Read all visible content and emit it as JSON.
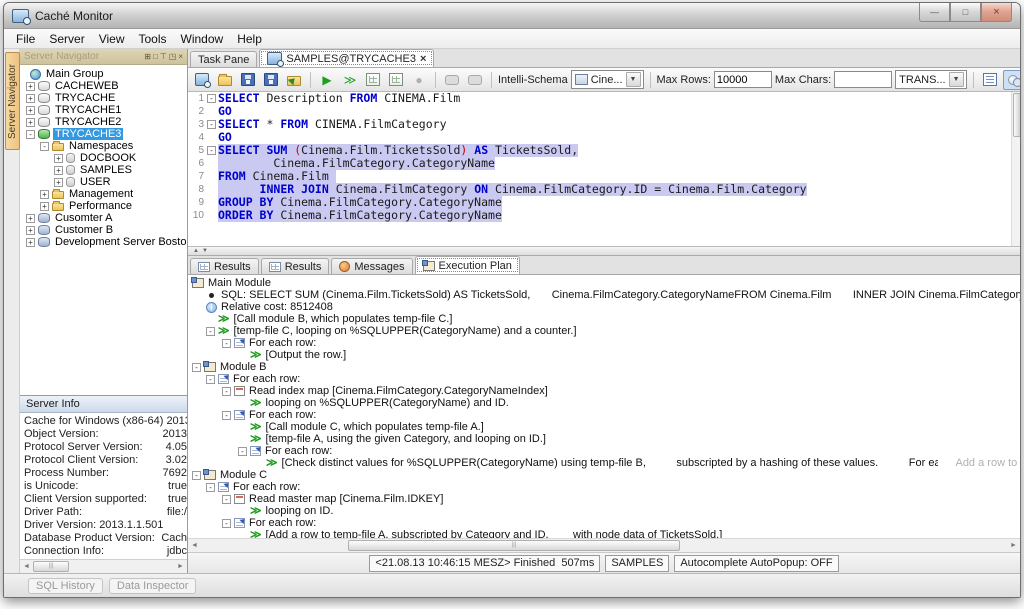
{
  "window": {
    "title": "Caché Monitor"
  },
  "icons": {
    "min": "—",
    "max": "□",
    "close": "×",
    "dock": "⊞",
    "pin": "⊤",
    "float": "◳",
    "plus": "+",
    "minus": "-",
    "dropdown": "▼",
    "play": "▶",
    "stop": "●",
    "up": "▲",
    "down": "▼",
    "left": "◄",
    "right": "►",
    "grip": "|||",
    "tabclose": "×",
    "info": "i",
    "go": "≫"
  },
  "menu": {
    "items": [
      "File",
      "Server",
      "View",
      "Tools",
      "Window",
      "Help"
    ]
  },
  "navigator": {
    "side_tab": "Server Navigator",
    "title": "Server Navigator",
    "tree": [
      {
        "label": "Main Group"
      },
      {
        "label": "CACHEWEB"
      },
      {
        "label": "TRYCACHE"
      },
      {
        "label": "TRYCACHE1"
      },
      {
        "label": "TRYCACHE2"
      },
      {
        "label": "TRYCACHE3"
      },
      {
        "label": "Namespaces"
      },
      {
        "label": "DOCBOOK"
      },
      {
        "label": "SAMPLES"
      },
      {
        "label": "USER"
      },
      {
        "label": "Management"
      },
      {
        "label": "Performance"
      },
      {
        "label": "Cusomter A"
      },
      {
        "label": "Customer B"
      },
      {
        "label": "Development Server Boston"
      }
    ]
  },
  "server_info": {
    "title": "Server Info",
    "rows": [
      {
        "label": "Cache for Windows (x86-64) 2013.",
        "value": ""
      },
      {
        "label": "Object Version:",
        "value": "2013"
      },
      {
        "label": "Protocol Server Version:",
        "value": "4.05"
      },
      {
        "label": "Protocol Client Version:",
        "value": "3.02"
      },
      {
        "label": "Process Number:",
        "value": "7692"
      },
      {
        "label": "is Unicode:",
        "value": "true"
      },
      {
        "label": "Client Version supported:",
        "value": "true"
      },
      {
        "label": "Driver Path:",
        "value": "file:/"
      },
      {
        "label": "Driver Version: 2013.1.1.501",
        "value": ""
      },
      {
        "label": "Database Product Version:",
        "value": "Cach"
      },
      {
        "label": "Connection Info:",
        "value": "jdbc"
      }
    ]
  },
  "tabs": {
    "task_pane": "Task Pane",
    "document": "SAMPLES@TRYCACHE3"
  },
  "toolbar": {
    "intelli_schema_label": "Intelli-Schema",
    "schema_combo": "Cine...",
    "max_rows_label": "Max Rows:",
    "max_rows_value": "10000",
    "max_chars_label": "Max Chars:",
    "max_chars_value": "",
    "trans_combo": "TRANS..."
  },
  "editor": {
    "lines": [
      {
        "num": "1",
        "segs": [
          {
            "t": "SELECT"
          },
          {
            "t": " Description "
          },
          {
            "t": "FROM"
          },
          {
            "t": " CINEMA.Film"
          }
        ]
      },
      {
        "num": "2",
        "segs": [
          {
            "t": "GO"
          }
        ]
      },
      {
        "num": "3",
        "segs": [
          {
            "t": "SELECT"
          },
          {
            "t": " * "
          },
          {
            "t": "FROM"
          },
          {
            "t": " CINEMA.FilmCategory"
          }
        ]
      },
      {
        "num": "4",
        "segs": [
          {
            "t": "GO"
          }
        ]
      },
      {
        "num": "5",
        "segs": [
          {
            "t": "SELECT"
          },
          {
            "t": " "
          },
          {
            "t": "SUM"
          },
          {
            "t": " "
          },
          {
            "t": "("
          },
          {
            "t": "Cinema.Film.TicketsSold"
          },
          {
            "t": ")"
          },
          {
            "t": " "
          },
          {
            "t": "AS"
          },
          {
            "t": " TicketsSold,"
          }
        ]
      },
      {
        "num": "6",
        "segs": [
          {
            "t": "        Cinema.FilmCategory.CategoryName"
          }
        ]
      },
      {
        "num": "7",
        "segs": [
          {
            "t": "FROM"
          },
          {
            "t": " Cinema.Film "
          }
        ]
      },
      {
        "num": "8",
        "segs": [
          {
            "t": "      "
          },
          {
            "t": "INNER JOIN"
          },
          {
            "t": " Cinema.FilmCategory "
          },
          {
            "t": "ON"
          },
          {
            "t": " Cinema.FilmCategory.ID = Cinema.Film.Category"
          }
        ]
      },
      {
        "num": "9",
        "segs": [
          {
            "t": "GROUP BY"
          },
          {
            "t": " Cinema.FilmCategory.CategoryName"
          }
        ]
      },
      {
        "num": "10",
        "segs": [
          {
            "t": "ORDER BY"
          },
          {
            "t": " Cinema.FilmCategory.CategoryName"
          }
        ]
      }
    ]
  },
  "result_tabs": {
    "results1": "Results",
    "results2": "Results",
    "messages": "Messages",
    "execution_plan": "Execution Plan"
  },
  "plan": {
    "rows": [
      {
        "text": "Main Module"
      },
      {
        "text": "SQL: SELECT SUM (Cinema.Film.TicketsSold) AS TicketsSold,       Cinema.FilmCategory.CategoryNameFROM Cinema.Film       INNER JOIN Cinema.FilmCategory ON Cinema.FilmCategory.I"
      },
      {
        "text": "Relative cost: 8512408"
      },
      {
        "text": "[Call module B, which populates temp-file C.]"
      },
      {
        "text": "[temp-file C, looping on %SQLUPPER(CategoryName) and a counter.]"
      },
      {
        "text": "For each row:"
      },
      {
        "text": "[Output the row.]"
      },
      {
        "text": "Module B"
      },
      {
        "text": "For each row:"
      },
      {
        "text": "Read index map [Cinema.FilmCategory.CategoryNameIndex]"
      },
      {
        "text": "looping on %SQLUPPER(CategoryName) and ID."
      },
      {
        "text": "For each row:"
      },
      {
        "text": "[Call module C, which populates temp-file A.]"
      },
      {
        "text": "[temp-file A, using the given Category, and looping on ID.]"
      },
      {
        "text": "For each row:"
      },
      {
        "text": "[Check distinct values for %SQLUPPER(CategoryName) using temp-file B,          subscripted by a hashing of these values.          For each distinct row:",
        "dim": "      Add a row to te"
      },
      {
        "text": "Module C"
      },
      {
        "text": "For each row:"
      },
      {
        "text": "Read master map [Cinema.Film.IDKEY]"
      },
      {
        "text": "looping on ID."
      },
      {
        "text": "For each row:"
      },
      {
        "text": "[Add a row to temp-file A, subscripted by Category and ID,        with node data of TicketsSold.]"
      }
    ]
  },
  "status": {
    "timing": "<21.08.13 10:46:15 MESZ> Finished  507ms",
    "namespace": "SAMPLES",
    "autocomplete": "Autocomplete AutoPopup: OFF"
  },
  "footer": {
    "sql_history": "SQL History",
    "data_inspector": "Data Inspector"
  }
}
